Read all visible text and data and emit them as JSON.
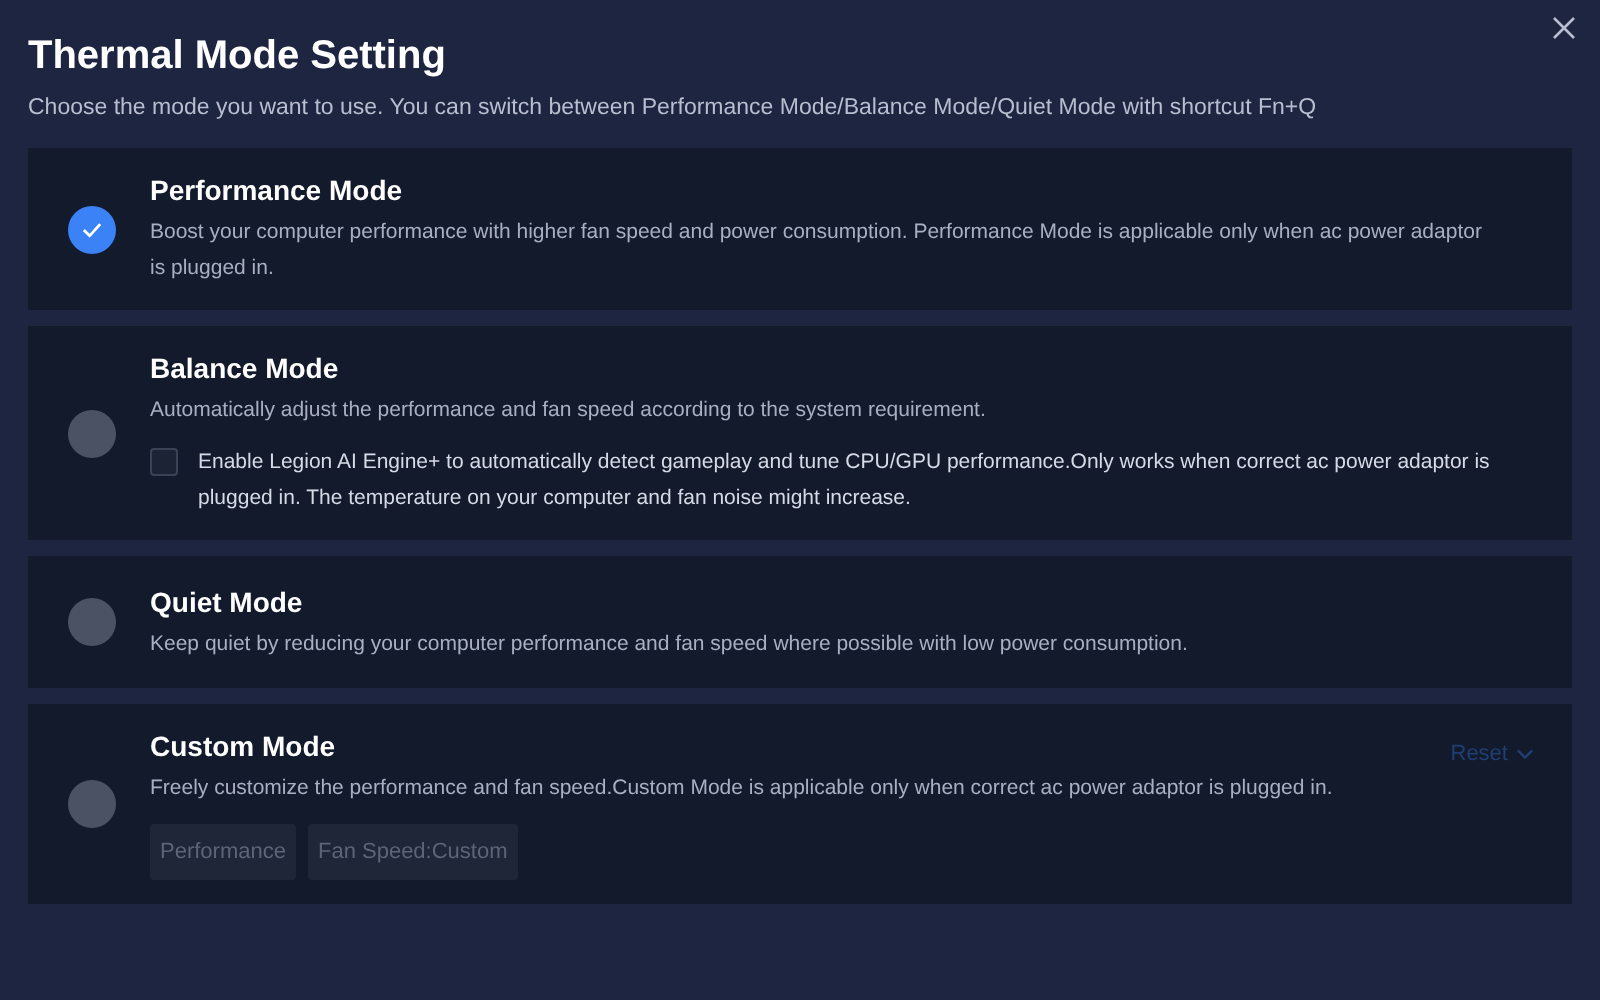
{
  "window": {
    "title": "Thermal Mode Setting",
    "subtitle": "Choose the mode you want to use. You can switch between Performance Mode/Balance Mode/Quiet Mode with shortcut Fn+Q"
  },
  "modes": [
    {
      "title": "Performance Mode",
      "description": "Boost your computer performance with higher fan speed and power consumption. Performance Mode is applicable only when ac power adaptor is plugged in.",
      "selected": true
    },
    {
      "title": "Balance Mode",
      "description": "Automatically adjust the performance and fan speed according to the system requirement.",
      "selected": false,
      "option": {
        "label": "Enable Legion AI Engine+ to automatically detect gameplay and tune CPU/GPU performance.Only works when correct ac power adaptor is plugged in. The temperature on your computer and fan noise might increase.",
        "checked": false
      }
    },
    {
      "title": "Quiet Mode",
      "description": "Keep quiet by reducing your computer performance and fan speed where possible with low power consumption.",
      "selected": false
    },
    {
      "title": "Custom Mode",
      "description": "Freely customize the performance and fan speed.Custom Mode is applicable only when correct ac power adaptor is plugged in.",
      "selected": false,
      "reset": "Reset",
      "chips": [
        "Performance",
        "Fan Speed:Custom"
      ]
    }
  ]
}
